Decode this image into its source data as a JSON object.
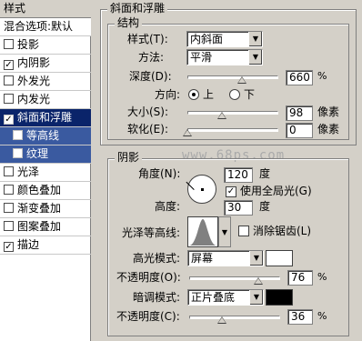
{
  "left_panel": {
    "header": "样式",
    "blend": "混合选项:默认",
    "items": [
      {
        "label": "投影",
        "checked": false
      },
      {
        "label": "内阴影",
        "checked": true
      },
      {
        "label": "外发光",
        "checked": false
      },
      {
        "label": "内发光",
        "checked": false
      },
      {
        "label": "斜面和浮雕",
        "checked": true
      },
      {
        "label": "等高线",
        "checked": false
      },
      {
        "label": "纹理",
        "checked": false
      },
      {
        "label": "光泽",
        "checked": false
      },
      {
        "label": "颜色叠加",
        "checked": false
      },
      {
        "label": "渐变叠加",
        "checked": false
      },
      {
        "label": "图案叠加",
        "checked": false
      },
      {
        "label": "描边",
        "checked": true
      }
    ],
    "check_mark": "✓"
  },
  "bevel": {
    "title": "斜面和浮雕",
    "structure_title": "结构",
    "style_label": "样式(T):",
    "style_value": "内斜面",
    "method_label": "方法:",
    "method_value": "平滑",
    "depth_label": "深度(D):",
    "depth_value": "660",
    "depth_unit": "%",
    "direction_label": "方向:",
    "dir_up": "上",
    "dir_down": "下",
    "size_label": "大小(S):",
    "size_value": "98",
    "size_unit": "像素",
    "soften_label": "软化(E):",
    "soften_value": "0",
    "soften_unit": "像素"
  },
  "shading": {
    "title": "阴影",
    "angle_label": "角度(N):",
    "angle_value": "120",
    "angle_unit": "度",
    "global_light_label": "使用全局光(G)",
    "altitude_label": "高度:",
    "altitude_value": "30",
    "altitude_unit": "度",
    "gloss_label": "光泽等高线:",
    "antialias_label": "消除锯齿(L)",
    "highlight_label": "高光模式:",
    "highlight_value": "屏幕",
    "highlight_color": "#ffffff",
    "opacity1_label": "不透明度(O):",
    "opacity1_value": "76",
    "opacity1_unit": "%",
    "shadow_label": "暗调模式:",
    "shadow_value": "正片叠底",
    "shadow_color": "#000000",
    "opacity2_label": "不透明度(C):",
    "opacity2_value": "36",
    "opacity2_unit": "%"
  },
  "watermark": "www.68ps.com",
  "dropdown_arrow": "▼",
  "slider_levels": {
    "depth": 0.6,
    "size": 0.38,
    "soften": 0.0,
    "opacity1": 0.76,
    "opacity2": 0.36
  }
}
